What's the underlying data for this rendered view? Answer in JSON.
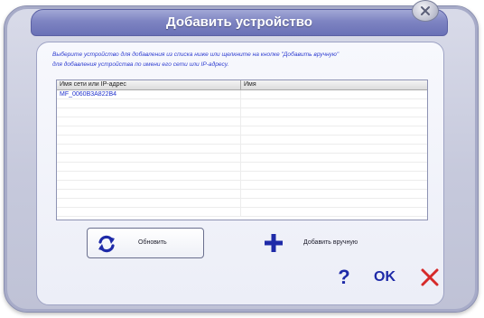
{
  "window": {
    "title": "Добавить устройство",
    "close_icon": "close-icon"
  },
  "instruction": {
    "line1": "Выберите устройство для добавления из списка ниже или щелкните на кнопке \"Добавить вручную\"",
    "line2": "для добавления устройства по имени его сети или IP-адресу."
  },
  "device_table": {
    "columns": [
      "Имя сети или IP-адрес",
      "Имя"
    ],
    "rows": [
      {
        "address": "MF_0060B3A822B4",
        "name": ""
      }
    ],
    "empty_row_count": 13
  },
  "buttons": {
    "refresh_label": "Обновить",
    "refresh_icon": "refresh-icon",
    "add_manual_label": "Добавить вручную",
    "add_icon": "plus-icon",
    "help_label": "?",
    "ok_label": "OK",
    "cancel_icon": "x-icon"
  },
  "colors": {
    "title_bar": "#7e84c2",
    "instruction_text": "#2e3dd0",
    "accent_blue": "#1e2aa8",
    "cancel_red": "#d62a2a"
  }
}
